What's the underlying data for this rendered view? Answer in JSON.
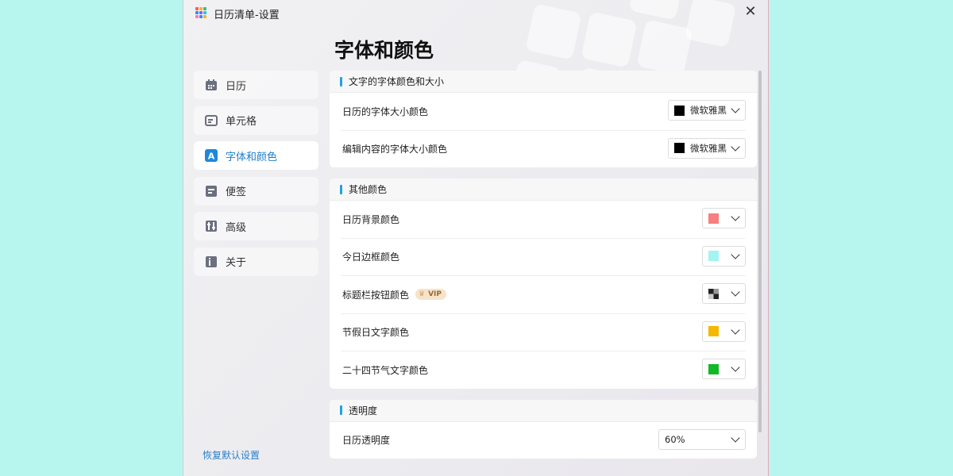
{
  "window": {
    "title": "日历清单-设置",
    "close_symbol": "✕"
  },
  "page": {
    "title": "字体和颜色"
  },
  "sidebar": {
    "items": [
      {
        "label": "日历",
        "icon": "calendar-icon",
        "active": false
      },
      {
        "label": "单元格",
        "icon": "cell-icon",
        "active": false
      },
      {
        "label": "字体和颜色",
        "icon": "font-color-icon",
        "active": true
      },
      {
        "label": "便签",
        "icon": "note-icon",
        "active": false
      },
      {
        "label": "高级",
        "icon": "advanced-icon",
        "active": false
      },
      {
        "label": "关于",
        "icon": "info-icon",
        "active": false
      }
    ],
    "reset_label": "恢复默认设置"
  },
  "sections": {
    "font": {
      "title": "文字的字体颜色和大小",
      "rows": [
        {
          "label": "日历的字体大小颜色",
          "font": "微软雅黑",
          "color": "#000000"
        },
        {
          "label": "编辑内容的字体大小颜色",
          "font": "微软雅黑",
          "color": "#000000"
        }
      ]
    },
    "other_colors": {
      "title": "其他颜色",
      "rows": [
        {
          "label": "日历背景颜色",
          "color": "#f77f7f"
        },
        {
          "label": "今日边框颜色",
          "color": "#a3f4f2"
        },
        {
          "label": "标题栏按钮颜色",
          "color": "mixed",
          "badge": "VIP"
        },
        {
          "label": "节假日文字颜色",
          "color": "#f5b800"
        },
        {
          "label": "二十四节气文字颜色",
          "color": "#12b826"
        }
      ]
    },
    "opacity": {
      "title": "透明度",
      "rows": [
        {
          "label": "日历透明度",
          "value": "60%"
        }
      ]
    }
  },
  "colors": {
    "accent": "#1fa3e0",
    "link": "#2a7fc9",
    "page_bg": "#b7f6ef"
  }
}
